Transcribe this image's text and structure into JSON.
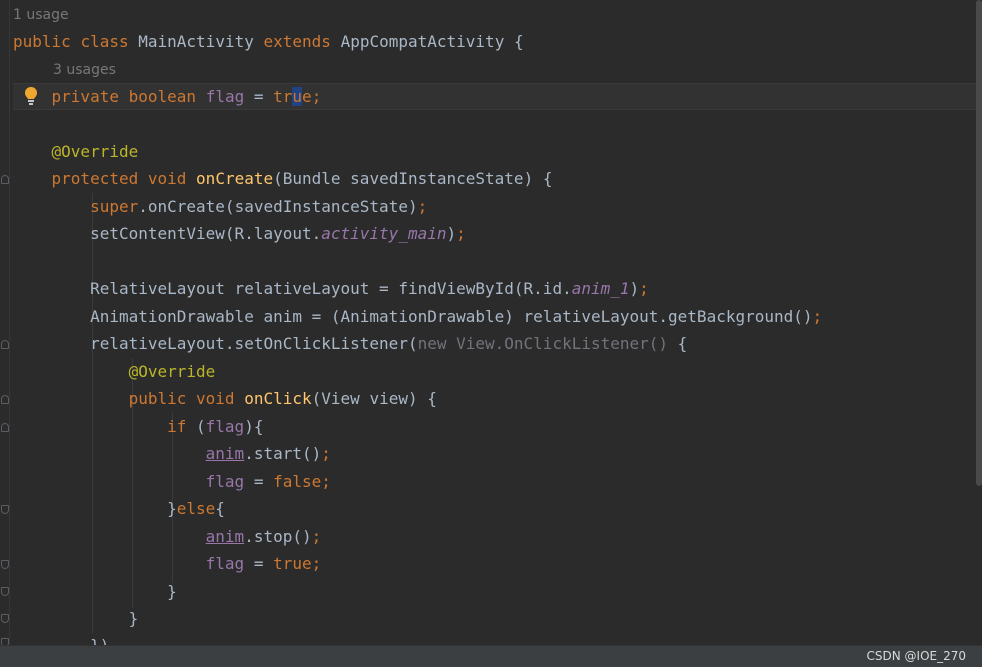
{
  "hints": {
    "class_usage": "1 usage",
    "field_usage": "3 usages"
  },
  "code": {
    "l1": [
      "public",
      "class",
      "MainActivity",
      "extends",
      "AppCompatActivity",
      "{"
    ],
    "l2": [
      "private",
      "boolean",
      "flag",
      "=",
      "tr",
      "u",
      "e",
      ";"
    ],
    "l3": [
      "@Override"
    ],
    "l4": [
      "protected",
      "void",
      "onCreate",
      "(Bundle savedInstanceState) {"
    ],
    "l5": [
      "super",
      ".onCreate(savedInstanceState)",
      ";"
    ],
    "l6": [
      "setContentView(R.layout.",
      "activity_main",
      ")",
      ";"
    ],
    "l7": [
      "RelativeLayout relativeLayout = findViewById(R.id.",
      "anim_1",
      ")",
      ";"
    ],
    "l8": [
      "AnimationDrawable anim = (AnimationDrawable) relativeLayout.getBackground()",
      ";"
    ],
    "l9": [
      "relativeLayout.setOnClickListener(",
      "new View.OnClickListener()",
      " {"
    ],
    "l10": [
      "@Override"
    ],
    "l11": [
      "public",
      "void",
      "onClick",
      "(View view) {"
    ],
    "l12": [
      "if",
      " (",
      "flag",
      "){"
    ],
    "l13": [
      "anim",
      ".start()",
      ";"
    ],
    "l14": [
      "flag",
      " = ",
      "false",
      ";"
    ],
    "l15": [
      "}",
      "else",
      "{"
    ],
    "l16": [
      "anim",
      ".stop()",
      ";"
    ],
    "l17": [
      "flag",
      " = ",
      "true",
      ";"
    ],
    "l18": [
      "}"
    ],
    "l19": [
      "}"
    ],
    "l20": [
      "})"
    ]
  },
  "status": {
    "watermark": "CSDN @IOE_270"
  },
  "colors": {
    "keyword": "#cc7832",
    "method": "#ffc66d",
    "annotation": "#bbb529",
    "field": "#9876aa",
    "text": "#a9b7c6",
    "background": "#2b2b2b"
  },
  "icons": {
    "intention": "lightbulb-icon",
    "fold": "fold-marker-icon"
  }
}
